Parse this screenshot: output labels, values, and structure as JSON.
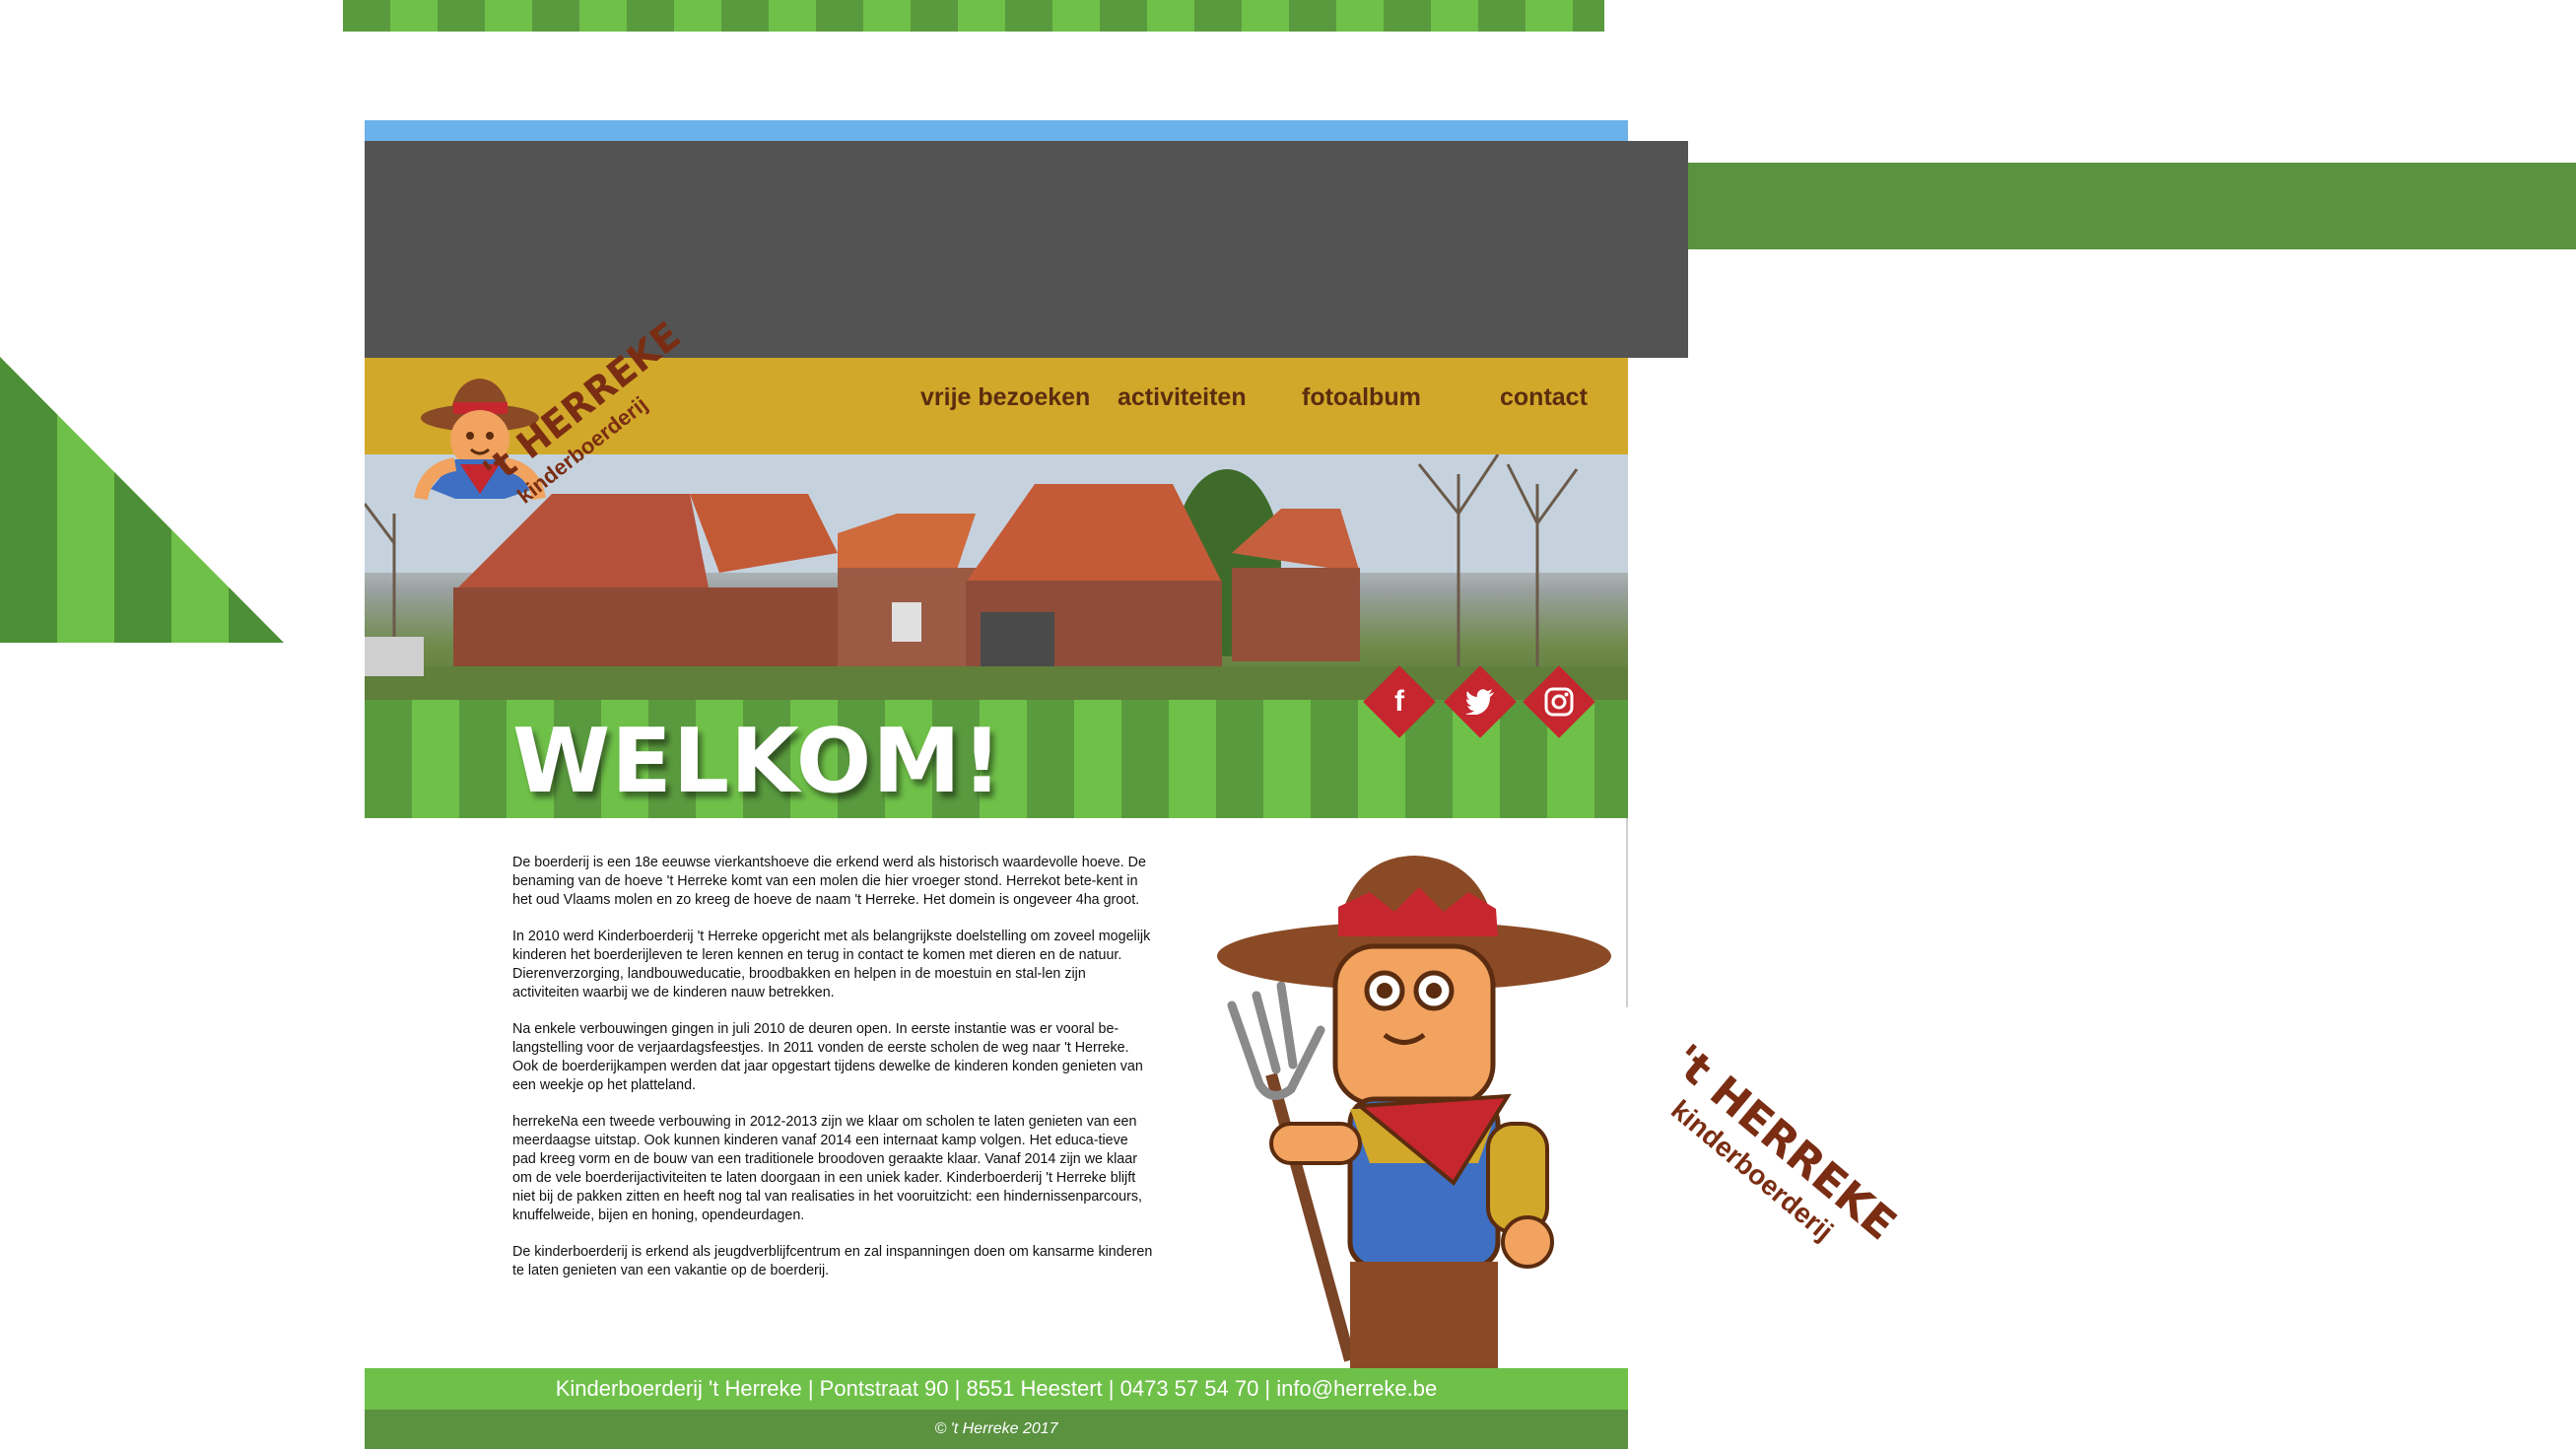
{
  "nav": {
    "items": [
      {
        "label": "vrije bezoeken"
      },
      {
        "label": "activiteiten"
      },
      {
        "label": "fotoalbum"
      },
      {
        "label": "contact"
      }
    ]
  },
  "logo": {
    "title": "'t HERREKE",
    "subtitle": "kinderboerderij"
  },
  "social": [
    "facebook-icon",
    "twitter-icon",
    "instagram-icon"
  ],
  "welcome": {
    "title": "WELKOM!"
  },
  "intro": {
    "paragraphs": [
      "De boerderij is een 18e eeuwse vierkantshoeve die erkend werd als historisch waardevolle hoeve. De benaming van de hoeve 't Herreke komt van een molen die hier vroeger stond. Herrekot bete-kent in het oud Vlaams molen en zo kreeg de hoeve de naam 't Herreke. Het domein is ongeveer 4ha groot.",
      "In 2010 werd Kinderboerderij 't Herreke opgericht met als belangrijkste doelstelling om zoveel mogelijk kinderen het boerderijleven te leren kennen en terug in contact te komen met dieren en de natuur. Dierenverzorging, landbouweducatie, broodbakken en helpen in de moestuin en stal-len zijn activiteiten waarbij we de kinderen nauw betrekken.",
      "Na enkele verbouwingen gingen in juli 2010 de deuren open. In eerste instantie was er vooral be-langstelling voor de verjaardagsfeestjes. In 2011 vonden de eerste scholen de weg naar 't Herreke. Ook de boerderijkampen werden dat jaar opgestart tijdens dewelke de kinderen konden genieten van een weekje op het platteland.",
      "herrekeNa een tweede verbouwing in 2012-2013 zijn we klaar om scholen te laten genieten van een meerdaagse uitstap. Ook kunnen kinderen vanaf 2014 een internaat kamp volgen. Het educa-tieve pad kreeg vorm en de bouw van een traditionele broodoven geraakte klaar. Vanaf 2014 zijn we klaar om de vele boerderijactiviteiten te laten doorgaan in een uniek kader. Kinderboerderij 't Herreke blijft niet bij de pakken zitten en heeft nog tal van realisaties in het vooruitzicht: een hindernissenparcours, knuffelweide, bijen en honing, opendeurdagen.",
      "De kinderboerderij is erkend als jeugdverblijfcentrum en zal inspanningen doen om kansarme kinderen te laten genieten van een vakantie op de boerderij."
    ]
  },
  "side_logo": {
    "title": "'t HERREKE",
    "subtitle": "kinderboerderij"
  },
  "footer": {
    "info": "Kinderboerderij 't Herreke | Pontstraat 90 | 8551 Heestert | 0473 57 54 70 | info@herreke.be",
    "copyright": "© 't Herreke 2017"
  },
  "colors": {
    "nav_bg": "#d1a82a",
    "nav_text": "#5b2c0f",
    "green_dark": "#5a9a3e",
    "green_light": "#6fc049",
    "social_red": "#c6262e",
    "brand_brown": "#7a2d12"
  }
}
